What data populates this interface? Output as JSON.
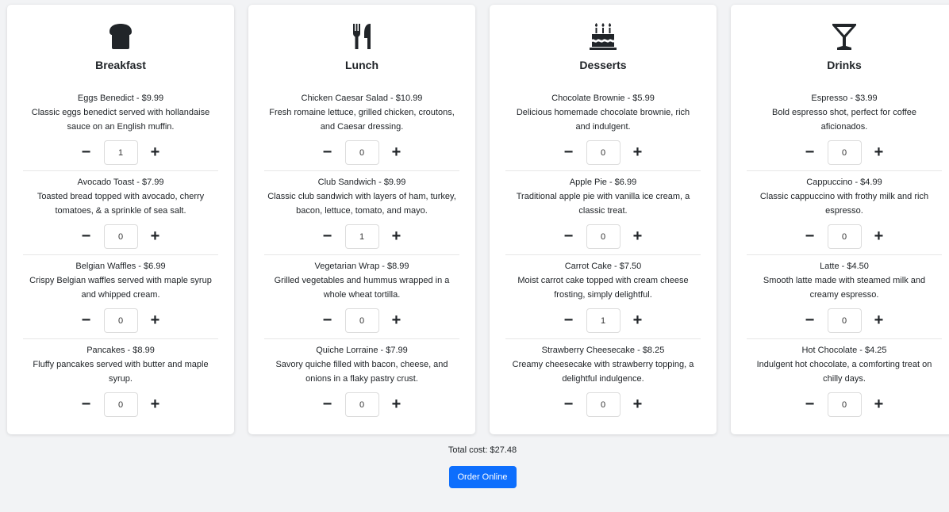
{
  "categories": [
    {
      "title": "Breakfast",
      "icon": "bread-icon",
      "items": [
        {
          "name": "Eggs Benedict",
          "price": "$9.99",
          "desc": "Classic eggs benedict served with hollandaise sauce on an English muffin.",
          "qty": "1"
        },
        {
          "name": "Avocado Toast",
          "price": "$7.99",
          "desc": "Toasted bread topped with avocado, cherry tomatoes, & a sprinkle of sea salt.",
          "qty": "0"
        },
        {
          "name": "Belgian Waffles",
          "price": "$6.99",
          "desc": "Crispy Belgian waffles served with maple syrup and whipped cream.",
          "qty": "0"
        },
        {
          "name": "Pancakes",
          "price": "$8.99",
          "desc": "Fluffy pancakes served with butter and maple syrup.",
          "qty": "0"
        }
      ]
    },
    {
      "title": "Lunch",
      "icon": "utensils-icon",
      "items": [
        {
          "name": "Chicken Caesar Salad",
          "price": "$10.99",
          "desc": "Fresh romaine lettuce, grilled chicken, croutons, and Caesar dressing.",
          "qty": "0"
        },
        {
          "name": "Club Sandwich",
          "price": "$9.99",
          "desc": "Classic club sandwich with layers of ham, turkey, bacon, lettuce, tomato, and mayo.",
          "qty": "1"
        },
        {
          "name": "Vegetarian Wrap",
          "price": "$8.99",
          "desc": "Grilled vegetables and hummus wrapped in a whole wheat tortilla.",
          "qty": "0"
        },
        {
          "name": "Quiche Lorraine",
          "price": "$7.99",
          "desc": "Savory quiche filled with bacon, cheese, and onions in a flaky pastry crust.",
          "qty": "0"
        }
      ]
    },
    {
      "title": "Desserts",
      "icon": "birthday-cake-icon",
      "items": [
        {
          "name": "Chocolate Brownie",
          "price": "$5.99",
          "desc": "Delicious homemade chocolate brownie, rich and indulgent.",
          "qty": "0"
        },
        {
          "name": "Apple Pie",
          "price": "$6.99",
          "desc": "Traditional apple pie with vanilla ice cream, a classic treat.",
          "qty": "0"
        },
        {
          "name": "Carrot Cake",
          "price": "$7.50",
          "desc": "Moist carrot cake topped with cream cheese frosting, simply delightful.",
          "qty": "1"
        },
        {
          "name": "Strawberry Cheesecake",
          "price": "$8.25",
          "desc": "Creamy cheesecake with strawberry topping, a delightful indulgence.",
          "qty": "0"
        }
      ]
    },
    {
      "title": "Drinks",
      "icon": "cocktail-glass-icon",
      "items": [
        {
          "name": "Espresso",
          "price": "$3.99",
          "desc": "Bold espresso shot, perfect for coffee aficionados.",
          "qty": "0"
        },
        {
          "name": "Cappuccino",
          "price": "$4.99",
          "desc": "Classic cappuccino with frothy milk and rich espresso.",
          "qty": "0"
        },
        {
          "name": "Latte",
          "price": "$4.50",
          "desc": "Smooth latte made with steamed milk and creamy espresso.",
          "qty": "0"
        },
        {
          "name": "Hot Chocolate",
          "price": "$4.25",
          "desc": "Indulgent hot chocolate, a comforting treat on chilly days.",
          "qty": "0"
        }
      ]
    }
  ],
  "stepper": {
    "minus": "−",
    "plus": "+",
    "separator": " - "
  },
  "footer": {
    "total": "Total cost: $27.48",
    "order_label": "Order Online"
  },
  "colors": {
    "accent": "#0d6efd",
    "background": "#f2f3f5",
    "card": "#ffffff"
  }
}
